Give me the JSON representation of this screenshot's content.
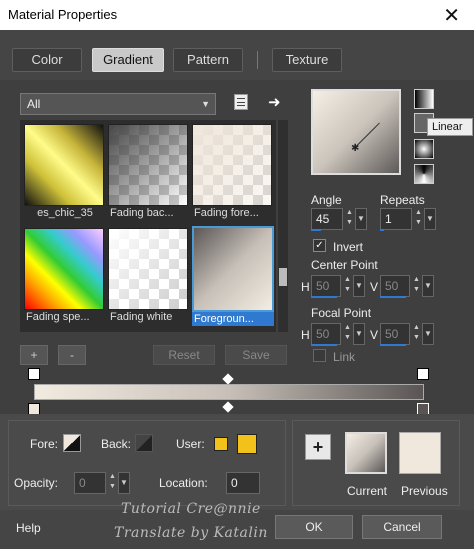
{
  "window": {
    "title": "Material Properties",
    "close": "✕"
  },
  "tabs": [
    {
      "label": "Color"
    },
    {
      "label": "Gradient"
    },
    {
      "label": "Pattern"
    },
    {
      "label": "Texture"
    }
  ],
  "active_tab": "Gradient",
  "library": {
    "filter": "All",
    "items": [
      {
        "label": "es_chic_35"
      },
      {
        "label": "Fading bac..."
      },
      {
        "label": "Fading fore..."
      },
      {
        "label": "Fading spe..."
      },
      {
        "label": "Fading white"
      },
      {
        "label": "Foregroun..."
      }
    ],
    "selected": "Foregroun...",
    "add": "+",
    "remove": "-",
    "reset": "Reset",
    "save": "Save"
  },
  "tooltip": "Linear",
  "angle": {
    "label": "Angle",
    "value": "45"
  },
  "repeats": {
    "label": "Repeats",
    "value": "1"
  },
  "invert": {
    "label": "Invert",
    "checked": true
  },
  "center_point": {
    "label": "Center Point",
    "h_label": "H",
    "h_value": "50",
    "v_label": "V",
    "v_value": "50"
  },
  "focal_point": {
    "label": "Focal Point",
    "h_label": "H",
    "h_value": "50",
    "v_label": "V",
    "v_value": "50"
  },
  "link": {
    "label": "Link"
  },
  "fore_label": "Fore:",
  "back_label": "Back:",
  "user_label": "User:",
  "opacity": {
    "label": "Opacity:",
    "value": "0"
  },
  "location": {
    "label": "Location:",
    "value": "0"
  },
  "current_label": "Current",
  "previous_label": "Previous",
  "plus": "+",
  "footer": {
    "help": "Help",
    "ok": "OK",
    "cancel": "Cancel"
  },
  "watermark": {
    "line1": "Tutorial Cre@nnie",
    "line2": "Translate by Katalin"
  },
  "colors": {
    "accent": "#2f7ad0",
    "user_swatch": "#f2c21b",
    "previous": "#f0e8dd"
  }
}
